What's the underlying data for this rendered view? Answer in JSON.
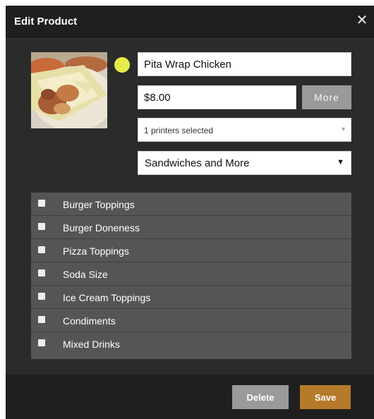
{
  "dialog": {
    "title": "Edit Product",
    "close_icon": "close-icon"
  },
  "product": {
    "name": "Pita Wrap Chicken",
    "price": "$8.00",
    "color": "#e6ec4a",
    "image_icon": "food-photo"
  },
  "buttons": {
    "more": "More",
    "delete": "Delete",
    "save": "Save"
  },
  "printers": {
    "selected_text": "1 printers selected"
  },
  "category": {
    "selected": "Sandwiches and More"
  },
  "option_groups": [
    {
      "label": "Burger Toppings",
      "checked": false
    },
    {
      "label": "Burger Doneness",
      "checked": false
    },
    {
      "label": "Pizza Toppings",
      "checked": false
    },
    {
      "label": "Soda Size",
      "checked": false
    },
    {
      "label": "Ice Cream Toppings",
      "checked": false
    },
    {
      "label": "Condiments",
      "checked": false
    },
    {
      "label": "Mixed Drinks",
      "checked": false
    }
  ],
  "colors": {
    "save_button": "#b57a2a",
    "delete_button": "#9a9a9a"
  }
}
